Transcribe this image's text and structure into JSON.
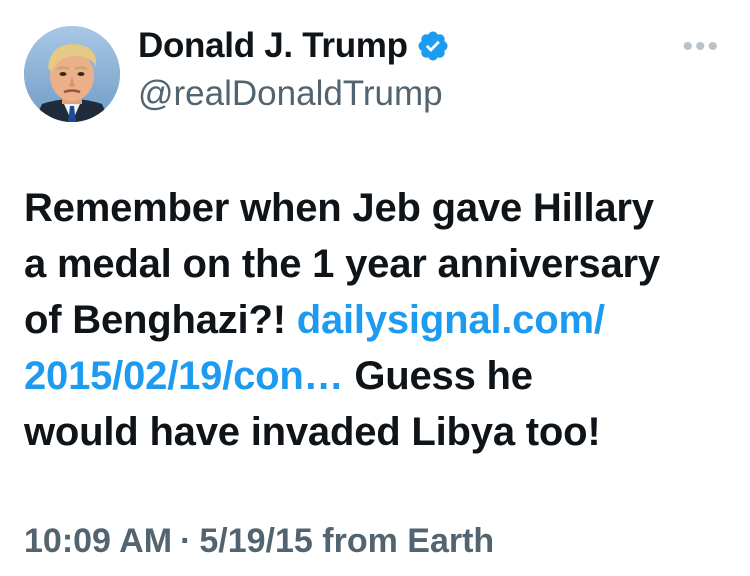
{
  "tweet": {
    "display_name": "Donald J. Trump",
    "handle": "@realDonaldTrump",
    "more_icon": "more-dots-icon",
    "verified_color": "#1d9bf0",
    "body": {
      "line1": "Remember when Jeb gave Hillary",
      "line2": "a medal on the 1 year anniversary",
      "line3_text": "of Benghazi?! ",
      "line3_link": "dailysignal.com/",
      "line4_link": "2015/02/19/con…",
      "line4_text": " Guess he",
      "line5": "would have invaded Libya too!"
    },
    "time": "10:09 AM",
    "separator": "·",
    "date": "5/19/15",
    "source": "from Earth"
  },
  "colors": {
    "text": "#0f1419",
    "secondary": "#536471",
    "link": "#1d9bf0"
  }
}
